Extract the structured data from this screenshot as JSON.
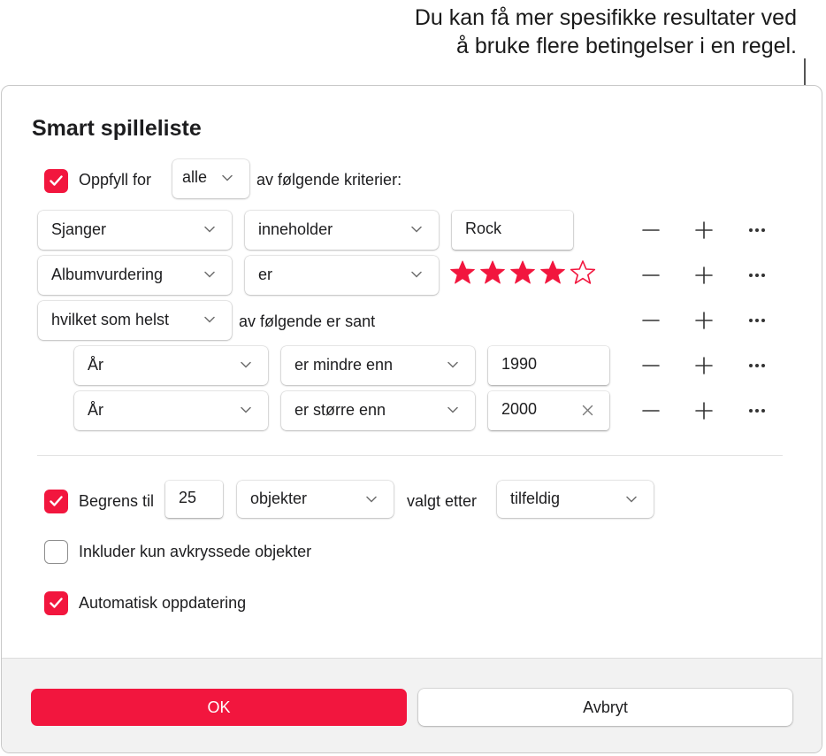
{
  "callout": {
    "line1": "Du kan få mer spesifikke resultater ved",
    "line2": "å bruke flere betingelser i en regel."
  },
  "dialog": {
    "title": "Smart spilleliste",
    "match": {
      "checked": true,
      "label": "Oppfyll for",
      "quantifier": "alle",
      "suffix": "av følgende kriterier:"
    },
    "rules": [
      {
        "field": "Sjanger",
        "operator": "inneholder",
        "value": "Rock"
      },
      {
        "field": "Albumvurdering",
        "operator": "er",
        "rating": 4,
        "rating_max": 5
      },
      {
        "group_quantifier": "hvilket som helst",
        "group_suffix": "av følgende er sant"
      }
    ],
    "subrules": [
      {
        "field": "År",
        "operator": "er mindre enn",
        "value": "1990"
      },
      {
        "field": "År",
        "operator": "er større enn",
        "value": "2000"
      }
    ],
    "limit": {
      "checked": true,
      "label": "Begrens til",
      "value": "25",
      "unit": "objekter",
      "selected_by_label": "valgt etter",
      "selected_by": "tilfeldig"
    },
    "checked_only": {
      "checked": false,
      "label": "Inkluder kun avkryssede objekter"
    },
    "live_update": {
      "checked": true,
      "label": "Automatisk oppdatering"
    },
    "buttons": {
      "ok": "OK",
      "cancel": "Avbryt"
    }
  },
  "colors": {
    "accent": "#f2163e",
    "star": "#f2163e",
    "footer": "#f2f2f2"
  },
  "icons": {
    "remove": "minus-icon",
    "add": "plus-icon",
    "more": "more-icon",
    "chevron": "chevron-down-icon",
    "clear": "clear-icon",
    "star_filled": "star-filled-icon",
    "star_empty": "star-outline-icon"
  }
}
